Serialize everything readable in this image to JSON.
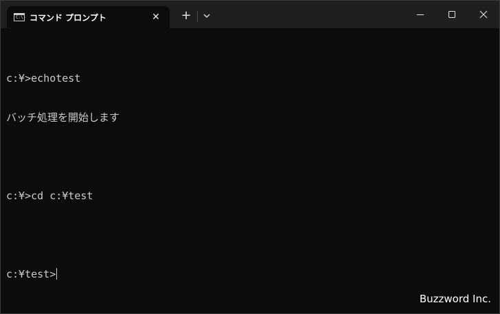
{
  "tab": {
    "title": "コマンド プロンプト",
    "icon": "console-icon",
    "icon_text": "C:\\",
    "close_glyph": "✕"
  },
  "titlebar": {
    "new_tab_glyph": "+",
    "dropdown_icon": "chevron-down-icon",
    "minimize_icon": "minimize-icon",
    "maximize_icon": "maximize-icon",
    "close_icon": "close-icon"
  },
  "terminal": {
    "lines": [
      "c:¥>echotest",
      "バッチ処理を開始します",
      "",
      "c:¥>cd c:¥test",
      "",
      "c:¥test>"
    ],
    "colors": {
      "background": "#0c0c0c",
      "foreground": "#cccccc"
    }
  },
  "watermark": "Buzzword Inc."
}
